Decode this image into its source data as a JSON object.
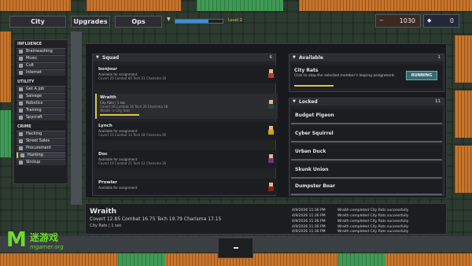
{
  "top_tabs": [
    "City",
    "Upgrades",
    "Ops"
  ],
  "level_label": "Level 2",
  "level_progress_percent": 70,
  "resources": [
    {
      "icon": "−",
      "value": "1030"
    },
    {
      "icon": "◆",
      "value": "0"
    }
  ],
  "sidebar": {
    "sections": [
      {
        "title": "INFLUENCE",
        "items": [
          "Brainwashing",
          "Music",
          "Cult",
          "Internet"
        ]
      },
      {
        "title": "UTILITY",
        "items": [
          "Get A Job",
          "Salvage",
          "Robotics",
          "Training",
          "Spycraft"
        ]
      },
      {
        "title": "CRIME",
        "items": [
          "Hacking",
          "Street Sales",
          "Procurement",
          "Hunting",
          "Stickup"
        ]
      }
    ],
    "active_item": "Hunting"
  },
  "squad": {
    "title": "Squad",
    "count": "6",
    "members": [
      {
        "name": "bonjour",
        "status": "Available for assignment",
        "stats": "Covert 20  Combat 80  Tech 21  Charisma 16",
        "task": "",
        "avatar_color": "#c0392b"
      },
      {
        "name": "Wraith",
        "status": "City Rats  |  1 sec",
        "stats": "Covert 26  Combat 16  Tech 20  Charisma 18",
        "task": "Wraith -> City Rats",
        "avatar_color": "#2c3e50"
      },
      {
        "name": "Lynch",
        "status": "Available for assignment",
        "stats": "Covert 10  Combat 14  Tech 18  Charisma 26",
        "task": "",
        "avatar_color": "#d4a017"
      },
      {
        "name": "Doc",
        "status": "Available for assignment",
        "stats": "Covert 19  Combat 21  Tech 12  Charisma 16",
        "task": "",
        "avatar_color": "#6c3483"
      },
      {
        "name": "Prowler",
        "status": "Available for assignment",
        "stats": "Covert 15  Combat 18  Tech 16  Charisma 20",
        "task": "",
        "avatar_color": "#7b241c"
      }
    ]
  },
  "available": {
    "title": "Available",
    "count": "1",
    "job_name": "City Rats",
    "job_help": "Click to stop the selected member's looping assignment.",
    "button_label": "RUNNING"
  },
  "locked": {
    "title": "Locked",
    "count": "11",
    "items": [
      "Budget Pigeon",
      "Cyber Squirrel",
      "Urban Duck",
      "Skunk Union",
      "Dumpster Boar"
    ]
  },
  "detail": {
    "name": "Wraith",
    "stats": "Covert 12.85   Combat 16.75   Tech 19.79   Charisma 17.15",
    "task": "City Rats | 1 sec"
  },
  "log": [
    {
      "time": "4/9/2026 11:36 PM",
      "text": "Wraith completed City Rats successfully"
    },
    {
      "time": "4/9/2026 11:36 PM",
      "text": "Wraith completed City Rats successfully"
    },
    {
      "time": "4/9/2026 11:36 PM",
      "text": "Wraith completed City Rats successfully"
    },
    {
      "time": "4/9/2026 11:36 PM",
      "text": "Wraith completed City Rats successfully"
    },
    {
      "time": "4/9/2026 11:36 PM",
      "text": "Wraith completed City Rats successfully"
    }
  ],
  "watermark": {
    "mark": "M",
    "cn": "迷游戏",
    "en": "mgamer.org"
  }
}
